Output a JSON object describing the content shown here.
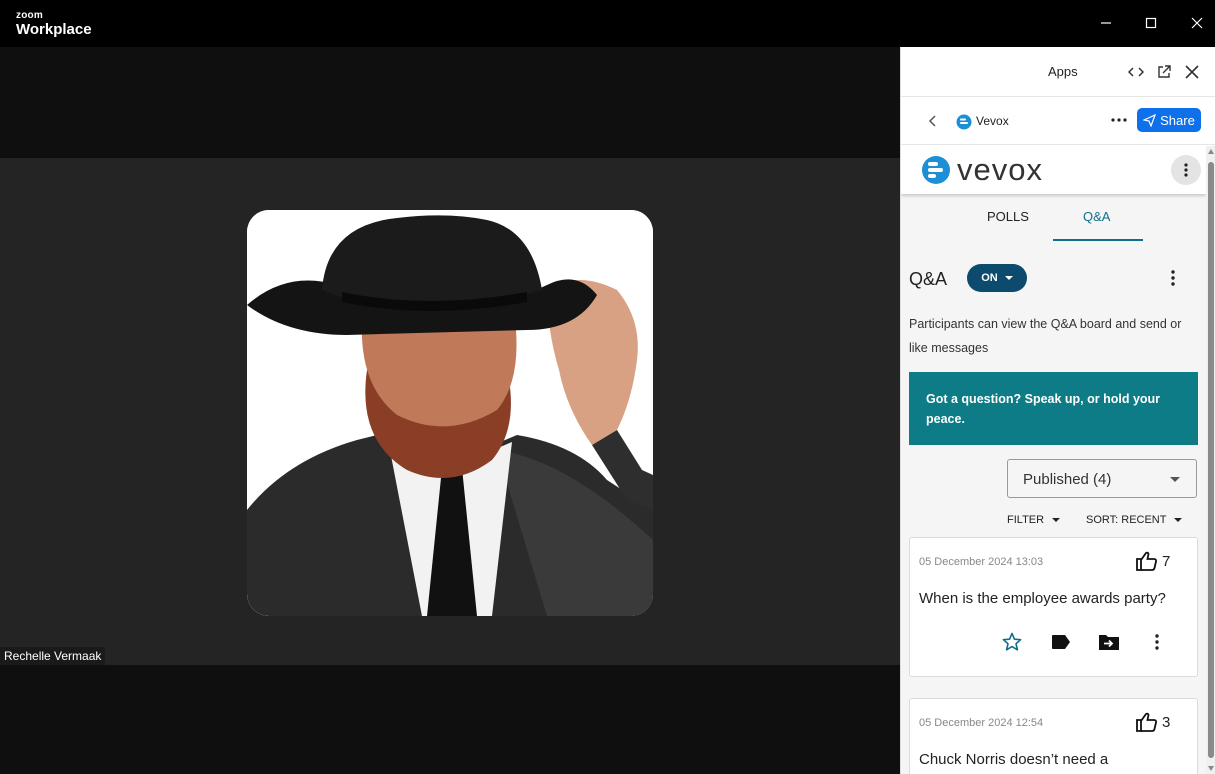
{
  "window": {
    "brand_small": "zoom",
    "brand_big": "Workplace"
  },
  "video": {
    "participant_name": "Rechelle Vermaak"
  },
  "panel": {
    "header_title": "Apps",
    "app_name": "Vevox",
    "share_label": "Share"
  },
  "vevox": {
    "logo_text": "vevox",
    "tabs": [
      {
        "label": "POLLS"
      },
      {
        "label": "Q&A"
      }
    ],
    "qa_title": "Q&A",
    "qa_status": "ON",
    "qa_description": "Participants can view the Q&A board and send or like messages",
    "banner_text": "Got a question? Speak up, or hold your peace.",
    "filter_select_value": "Published (4)",
    "filter_label": "FILTER",
    "sort_label": "SORT: RECENT",
    "questions": [
      {
        "date": "05 December 2024 13:03",
        "likes": "7",
        "text": "When is the employee awards party?"
      },
      {
        "date": "05 December 2024 12:54",
        "likes": "3",
        "text": "Chuck Norris doesn’t need a"
      }
    ]
  },
  "colors": {
    "zoom_blue": "#0e71eb",
    "vevox_teal": "#0e7c86",
    "vevox_navy": "#0c4a6e",
    "tab_active": "#0f6e8c"
  }
}
